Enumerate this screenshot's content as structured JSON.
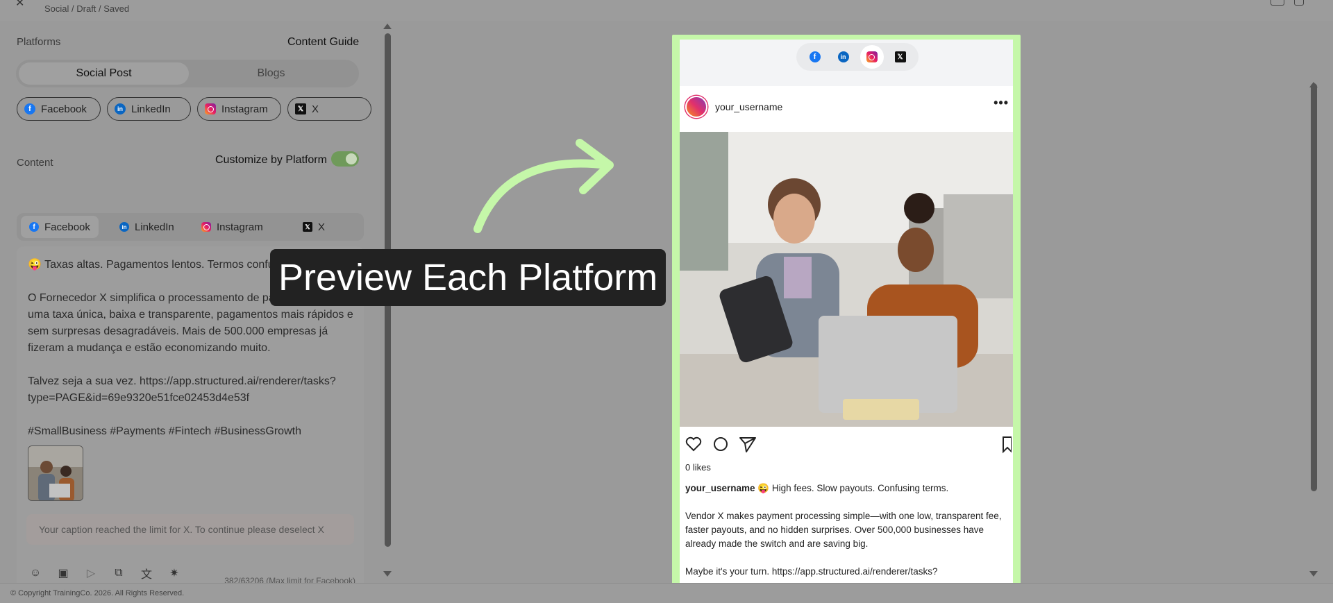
{
  "breadcrumb": "Social / Draft / Saved",
  "platforms_label": "Platforms",
  "content_guide": "Content Guide",
  "segment": {
    "active": "Social Post",
    "inactive": "Blogs"
  },
  "platform_pills": [
    "Facebook",
    "LinkedIn",
    "Instagram",
    "X"
  ],
  "content_label": "Content",
  "customize_label": "Customize by Platform",
  "customize_enabled": true,
  "content_tabs": [
    "Facebook",
    "LinkedIn",
    "Instagram",
    "X"
  ],
  "active_content_tab": "Facebook",
  "editor_text": "😜 Taxas altas. Pagamentos lentos. Termos confusos.\n\nO Fornecedor X simplifica o processamento de pagamentos com uma taxa única, baixa e transparente, pagamentos mais rápidos e sem surpresas desagradáveis. Mais de 500.000 empresas já fizeram a mudança e estão economizando muito.\n\nTalvez seja a sua vez. https://app.structured.ai/renderer/tasks?type=PAGE&id=69e9320e51fce02453d4e53f\n\n#SmallBusiness #Payments #Fintech #BusinessGrowth",
  "warning": "Your caption reached the limit for X. To continue please deselect X",
  "counter": "382/63206 (Max limit for Facebook)",
  "footer": "© Copyright TrainingCo. 2026. All Rights Reserved.",
  "callout": "Preview Each Platform",
  "preview": {
    "active_platform": "Instagram",
    "username": "your_username",
    "likes": "0 likes",
    "caption_user": "your_username",
    "caption_text": " 😜 High fees. Slow payouts. Confusing terms.\n\nVendor X makes payment processing simple—with one low, transparent fee, faster payouts, and no hidden surprises. Over 500,000 businesses have already made the switch and are saving big.\n\nMaybe it's your turn. https://app.structured.ai/renderer/tasks?"
  },
  "colors": {
    "highlight": "#c5f7a9",
    "facebook": "#1877f2",
    "linkedin": "#0a66c2",
    "toggle_on": "#6f9a5a"
  }
}
